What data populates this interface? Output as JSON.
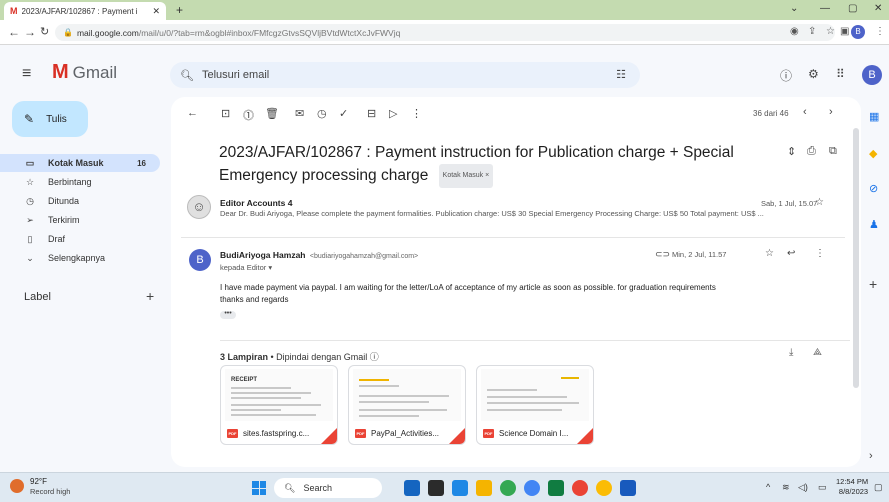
{
  "browser": {
    "tab_title": "2023/AJFAR/102867 : Payment i",
    "tab_close": "✕",
    "new_tab": "+",
    "url_main": "mail.google.com",
    "url_rest": "/mail/u/0/?tab=rm&ogbl#inbox/FMfcgzGtvsSQVljBVtdWtctXcJvFWVjq",
    "profile_initial": "B"
  },
  "gmail": {
    "app_name": "Gmail",
    "search_placeholder": "Telusuri email",
    "account_initial": "B"
  },
  "sidebar": {
    "compose_label": "Tulis",
    "items": [
      {
        "label": "Kotak Masuk",
        "count": "16",
        "icon": "inbox-icon"
      },
      {
        "label": "Berbintang",
        "count": "",
        "icon": "star-icon"
      },
      {
        "label": "Ditunda",
        "count": "",
        "icon": "clock-icon"
      },
      {
        "label": "Terkirim",
        "count": "",
        "icon": "send-icon"
      },
      {
        "label": "Draf",
        "count": "",
        "icon": "draft-icon"
      },
      {
        "label": "Selengkapnya",
        "count": "",
        "icon": "chevron-down-icon"
      }
    ],
    "labels_heading": "Label"
  },
  "toolbar": {
    "pager": "36 dari 46"
  },
  "thread": {
    "subject": "2023/AJFAR/102867 : Payment instruction for Publication charge + Special Emergency processing charge",
    "label_chip": "Kotak Masuk ×",
    "messages": [
      {
        "sender": "Editor Accounts 4",
        "date": "Sab, 1 Jul, 15.07",
        "snippet": "Dear Dr. Budi Ariyoga, Please complete the payment formalities. Publication charge: US$ 30 Special Emergency Processing Charge: US$ 50 Total payment: US$ ..."
      },
      {
        "sender": "BudiAriyoga Hamzah",
        "email": "<budiariyogahamzah@gmail.com>",
        "to": "kepada Editor ▾",
        "date": "Min, 2 Jul, 11.57",
        "avatar": "B",
        "body_line1": "I have made payment via paypal. I am waiting for the letter/LoA of acceptance of my article as soon as possible. for graduation requirements",
        "body_line2": "thanks and regards",
        "dots": "•••"
      }
    ],
    "attachments_count": "3 Lampiran",
    "attachments_scan": " • Dipindai dengan Gmail ⓘ",
    "attachments": [
      {
        "name": "sites.fastspring.c...",
        "preview_title": "RECEIPT"
      },
      {
        "name": "PayPal_Activities...",
        "preview_title": ""
      },
      {
        "name": "Science Domain I...",
        "preview_title": ""
      }
    ]
  },
  "taskbar": {
    "weather_temp": "92°F",
    "weather_desc": "Record high",
    "search_label": "Search",
    "time": "12:54 PM",
    "date": "8/8/2023"
  },
  "colors": {
    "compose_bg": "#c2e7ff",
    "active_item_bg": "#d3e3fd",
    "gmail_red": "#d93025",
    "avatar_blue": "#4e63c9"
  }
}
